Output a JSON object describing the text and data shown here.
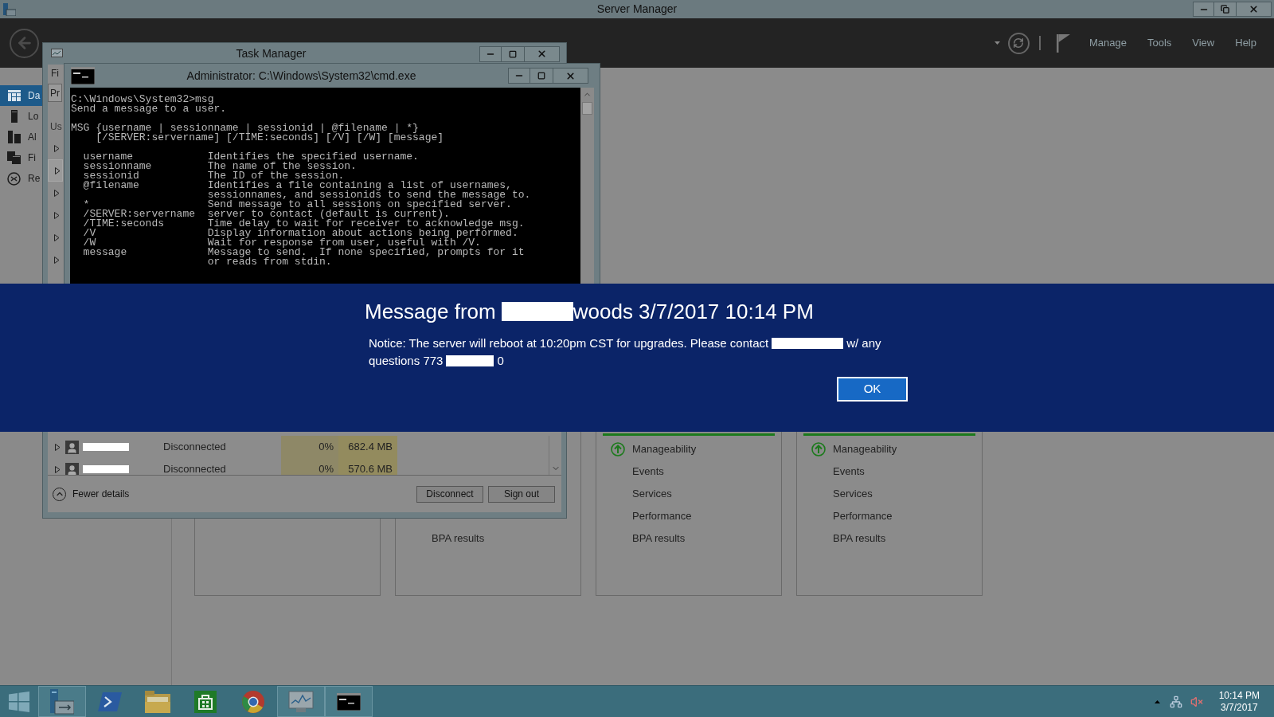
{
  "title_bar": {
    "title": "Server Manager"
  },
  "header": {
    "menu": [
      "Manage",
      "Tools",
      "View",
      "Help"
    ]
  },
  "sidebar": {
    "items": [
      {
        "label": "Da",
        "kind": "dashboard",
        "selected": true
      },
      {
        "label": "Lo",
        "kind": "server",
        "selected": false
      },
      {
        "label": "Al",
        "kind": "servers",
        "selected": false
      },
      {
        "label": "Fi",
        "kind": "files",
        "selected": false
      },
      {
        "label": "Re",
        "kind": "remote",
        "selected": false
      }
    ]
  },
  "tiles": [
    {
      "kind": "tile"
    },
    {
      "kind": "tile",
      "rows": [
        {
          "label": "BPA results",
          "healthy": false
        }
      ]
    },
    {
      "kind": "tile",
      "healthy": true,
      "rows": [
        {
          "label": "Manageability",
          "healthy": true
        },
        {
          "label": "Events",
          "healthy": false
        },
        {
          "label": "Services",
          "healthy": false
        },
        {
          "label": "Performance",
          "healthy": false
        },
        {
          "label": "BPA results",
          "healthy": false
        }
      ]
    },
    {
      "kind": "tile",
      "healthy": true,
      "rows": [
        {
          "label": "Manageability",
          "healthy": true
        },
        {
          "label": "Events",
          "healthy": false
        },
        {
          "label": "Services",
          "healthy": false
        },
        {
          "label": "Performance",
          "healthy": false
        },
        {
          "label": "BPA results",
          "healthy": false
        }
      ]
    }
  ],
  "task_manager": {
    "title": "Task Manager",
    "menu_partial": "Fi",
    "tab_partial": "Pr",
    "column_partial": "Us",
    "upper_rows": [
      {
        "selected": false,
        "expanded": false
      },
      {
        "selected": true,
        "expanded": false
      },
      {
        "selected": false,
        "expanded": false
      },
      {
        "selected": false,
        "expanded": false
      },
      {
        "selected": false,
        "expanded": false
      },
      {
        "selected": false,
        "expanded": false
      }
    ],
    "lower_rows": [
      {
        "expanded": false,
        "name_redacted": true,
        "status": "Disconnected",
        "cpu": "0%",
        "memory": "682.4 MB"
      },
      {
        "expanded": false,
        "name_redacted": true,
        "status": "Disconnected",
        "cpu": "0%",
        "memory": "570.6 MB"
      }
    ],
    "fewer_details": "Fewer details",
    "buttons": [
      "Disconnect",
      "Sign out"
    ]
  },
  "console": {
    "title": "Administrator: C:\\Windows\\System32\\cmd.exe",
    "blocks": [
      [
        "C:\\Windows\\System32>msg",
        "Send a message to a user."
      ],
      [
        "MSG {username | sessionname | sessionid | @filename | *}",
        "    [/SERVER:servername] [/TIME:seconds] [/V] [/W] [message]"
      ],
      [
        "  username            Identifies the specified username.",
        "  sessionname         The name of the session.",
        "  sessionid           The ID of the session.",
        "  @filename           Identifies a file containing a list of usernames,",
        "                      sessionnames, and sessionids to send the message to.",
        "  *                   Send message to all sessions on specified server.",
        "  /SERVER:servername  server to contact (default is current).",
        "  /TIME:seconds       Time delay to wait for receiver to acknowledge msg.",
        "  /V                  Display information about actions being performed.",
        "  /W                  Wait for response from user, useful with /V.",
        "  message             Message to send.  If none specified, prompts for it",
        "                      or reads from stdin."
      ]
    ]
  },
  "message": {
    "title": {
      "before": "Message from",
      "redacted": true,
      "after": "woods 3/7/2017 10:14 PM"
    },
    "body": [
      {
        "before": "Notice: The server will reboot at 10:20pm CST for upgrades. Please contact",
        "redacted": true,
        "after": "w/ any"
      },
      {
        "before": "questions 773",
        "redacted": true,
        "after": "0"
      }
    ],
    "button": "OK"
  },
  "taskbar": {
    "items": [
      {
        "kind": "start",
        "open": false
      },
      {
        "kind": "server-manager",
        "open": true
      },
      {
        "kind": "powershell",
        "open": false
      },
      {
        "kind": "explorer",
        "open": false
      },
      {
        "kind": "store",
        "open": false
      },
      {
        "kind": "chrome",
        "open": false
      },
      {
        "kind": "monitor",
        "open": true
      },
      {
        "kind": "console",
        "open": true
      }
    ],
    "clock": {
      "time": "10:14 PM",
      "date": "3/7/2017"
    }
  }
}
